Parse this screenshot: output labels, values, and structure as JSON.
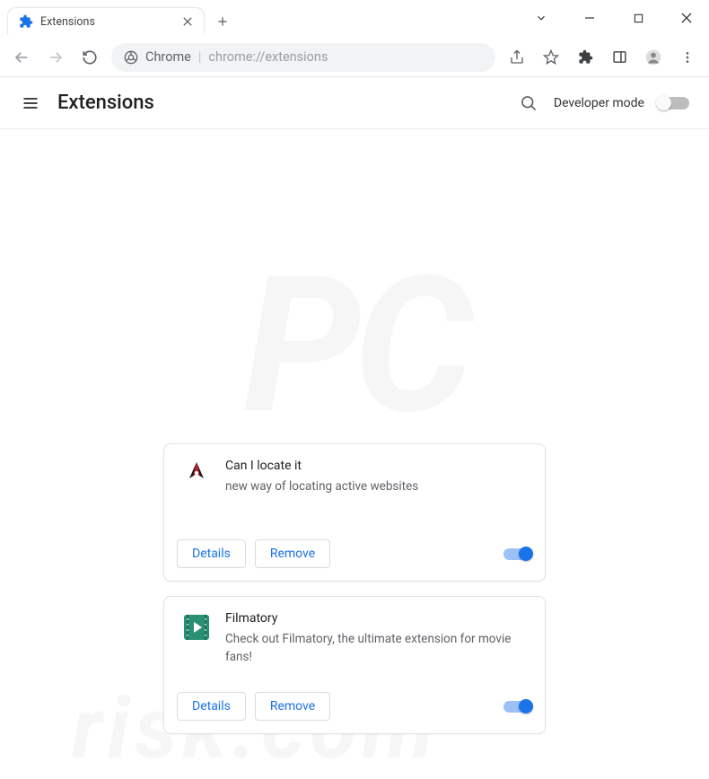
{
  "window": {
    "tab_title": "Extensions"
  },
  "address_bar": {
    "origin_label": "Chrome",
    "url": "chrome://extensions"
  },
  "page": {
    "title": "Extensions",
    "developer_mode_label": "Developer mode",
    "developer_mode_on": false
  },
  "extensions": [
    {
      "name": "Can I locate it",
      "description": "new way of locating active websites",
      "details_label": "Details",
      "remove_label": "Remove",
      "enabled": true,
      "icon": "bird"
    },
    {
      "name": "Filmatory",
      "description": "Check out Filmatory, the ultimate extension for movie fans!",
      "details_label": "Details",
      "remove_label": "Remove",
      "enabled": true,
      "icon": "film"
    }
  ],
  "watermark": {
    "line1": "PC",
    "line2": "risk.com"
  }
}
